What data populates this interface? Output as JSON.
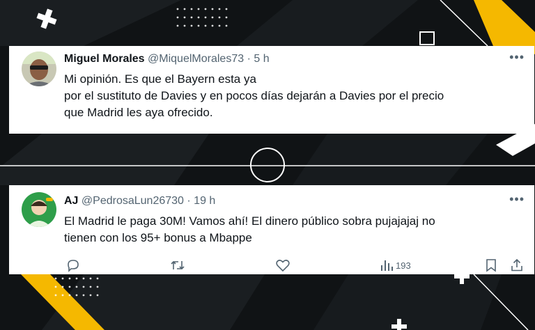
{
  "tweets": [
    {
      "name": "Miguel Morales",
      "handle": "@MiquelMorales73",
      "sep": "·",
      "time": "5 h",
      "more": "•••",
      "lines": [
        "Mi opinión. Es que el Bayern esta ya",
        "por el sustituto de Davies y en pocos días dejarán a Davies por el precio",
        "que Madrid les aya ofrecido."
      ]
    },
    {
      "name": "AJ",
      "handle": "@PedrosaLun26730",
      "sep": "·",
      "time": "19 h",
      "more": "•••",
      "lines": [
        "El Madrid le paga 30M! Vamos ahí! El dinero público sobra pujajajaj no",
        "tienen con los 95+ bonus a Mbappe"
      ],
      "views": "193"
    }
  ],
  "colors": {
    "background": "#0f1214",
    "accent": "#f5b800",
    "text_primary": "#0f1419",
    "text_secondary": "#536471"
  }
}
